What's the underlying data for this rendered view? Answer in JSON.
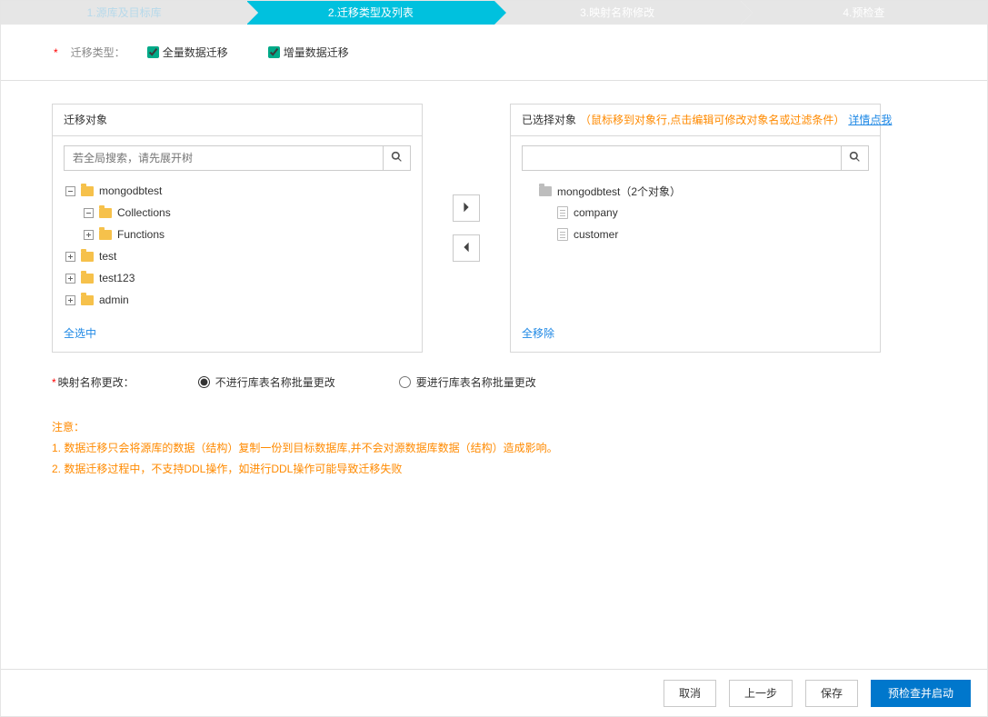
{
  "steps": {
    "s1": "1.源库及目标库",
    "s2": "2.迁移类型及列表",
    "s3": "3.映射名称修改",
    "s4": "4.预检查"
  },
  "typeRow": {
    "asterisk": "*",
    "label": "迁移类型：",
    "opt1": "全量数据迁移",
    "opt2": "增量数据迁移"
  },
  "leftPanel": {
    "title": "迁移对象",
    "searchPlaceholder": "若全局搜索，请先展开树",
    "tree": {
      "n0": "mongodbtest",
      "n0a": "Collections",
      "n0b": "Functions",
      "n1": "test",
      "n2": "test123",
      "n3": "admin"
    },
    "footer": "全选中"
  },
  "rightPanel": {
    "title1": "已选择对象",
    "title2": "（鼠标移到对象行,点击编辑可修改对象名或过滤条件）",
    "title3": "详情点我",
    "tree": {
      "r0": "mongodbtest（2个对象）",
      "r1": "company",
      "r2": "customer"
    },
    "footer": "全移除"
  },
  "mapRow": {
    "label": "映射名称更改：",
    "opt1": "不进行库表名称批量更改",
    "opt2": "要进行库表名称批量更改"
  },
  "notice": {
    "h": "注意：",
    "l1": "1. 数据迁移只会将源库的数据（结构）复制一份到目标数据库,并不会对源数据库数据（结构）造成影响。",
    "l2": "2. 数据迁移过程中，不支持DDL操作，如进行DDL操作可能导致迁移失败"
  },
  "footer": {
    "cancel": "取消",
    "prev": "上一步",
    "save": "保存",
    "precheck": "预检查并启动"
  }
}
